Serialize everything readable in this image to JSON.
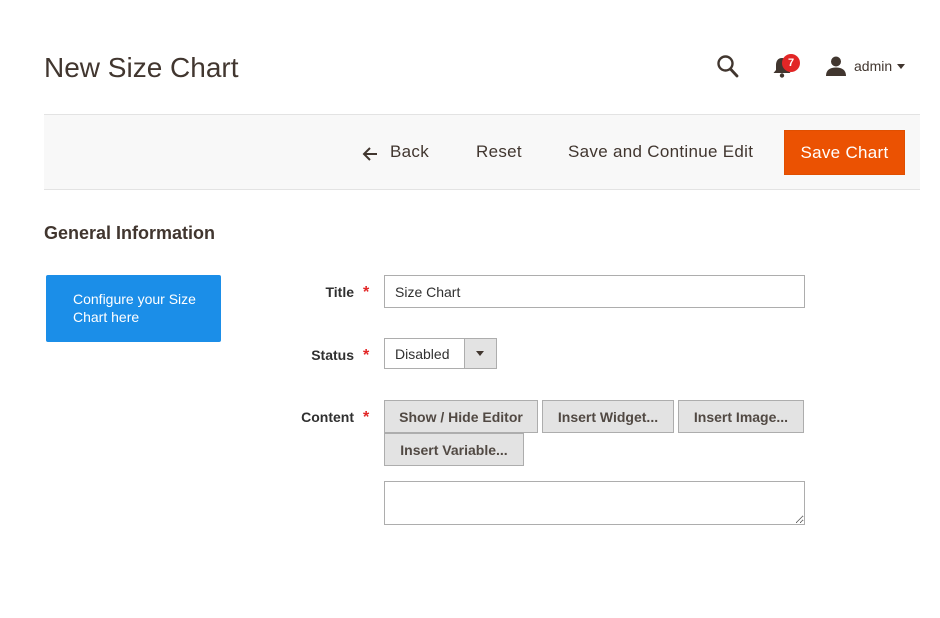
{
  "page": {
    "title": "New Size Chart"
  },
  "header": {
    "notification_count": "7",
    "user_name": "admin"
  },
  "actions": {
    "back_label": "Back",
    "reset_label": "Reset",
    "save_continue_label": "Save and Continue Edit",
    "save_label": "Save Chart"
  },
  "section": {
    "title": "General Information",
    "config_card_text": "Configure your Size Chart here"
  },
  "form": {
    "title_label": "Title",
    "title_value": "Size Chart",
    "status_label": "Status",
    "status_value": "Disabled",
    "content_label": "Content",
    "required_mark": "*",
    "editor_buttons": {
      "show_hide": "Show / Hide Editor",
      "insert_widget": "Insert Widget...",
      "insert_image": "Insert Image...",
      "insert_variable": "Insert Variable..."
    }
  },
  "colors": {
    "primary_action": "#eb5202",
    "config_card": "#1b8ee8",
    "badge": "#e22626",
    "required": "#e22626"
  },
  "icons": [
    "search-icon",
    "bell-icon",
    "user-icon",
    "chevron-down-icon",
    "arrow-left-icon"
  ]
}
